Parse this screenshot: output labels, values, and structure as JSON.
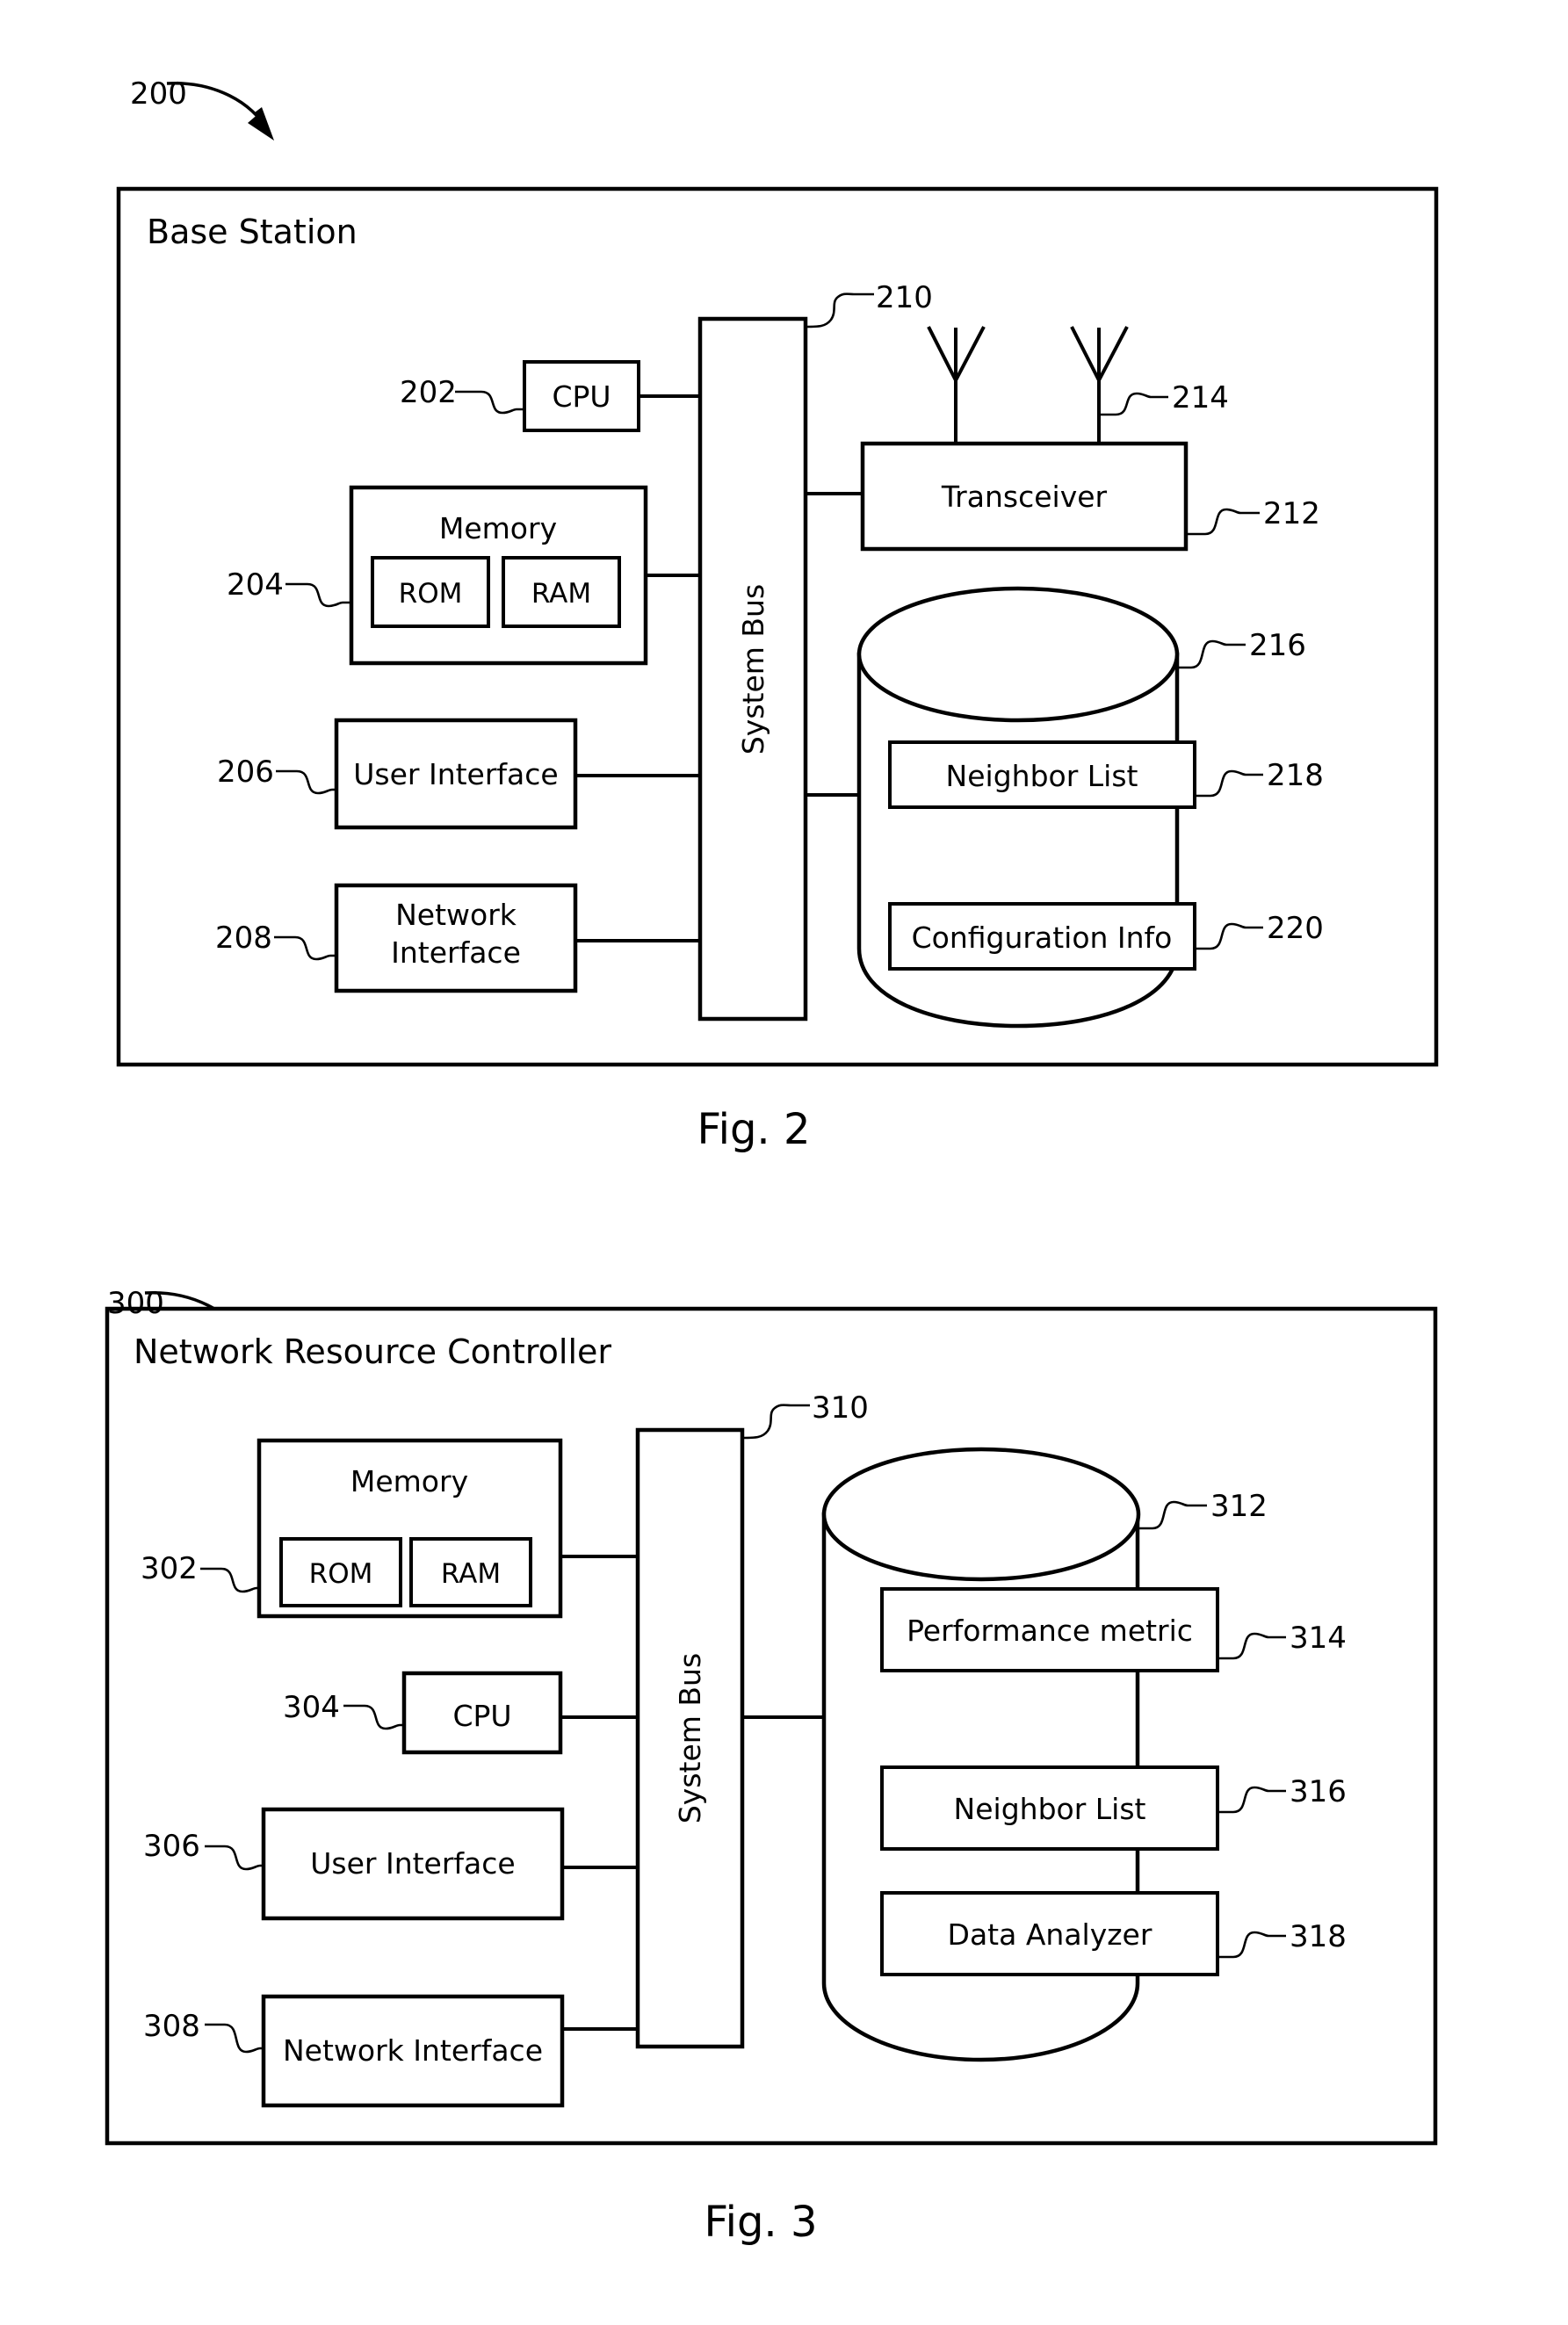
{
  "figures": [
    {
      "id": "fig2",
      "caption": "Fig. 2",
      "lead_ref": "200",
      "outer_label": "Base Station",
      "refs": {
        "cpu": "202",
        "memory": "204",
        "user_interface": "206",
        "network_interface": "208",
        "system_bus": "210",
        "transceiver": "212",
        "antenna": "214",
        "database": "216",
        "neighbor_list": "218",
        "configuration_info": "220"
      },
      "nodes": {
        "cpu": "CPU",
        "memory": "Memory",
        "rom": "ROM",
        "ram": "RAM",
        "user_interface": "User Interface",
        "network_interface_line1": "Network",
        "network_interface_line2": "Interface",
        "system_bus": "System Bus",
        "transceiver": "Transceiver",
        "neighbor_list": "Neighbor List",
        "configuration_info": "Configuration Info"
      }
    },
    {
      "id": "fig3",
      "caption": "Fig. 3",
      "lead_ref": "300",
      "outer_label": "Network Resource Controller",
      "refs": {
        "memory": "302",
        "cpu": "304",
        "user_interface": "306",
        "network_interface": "308",
        "system_bus": "310",
        "database": "312",
        "performance_metric": "314",
        "neighbor_list": "316",
        "data_analyzer": "318"
      },
      "nodes": {
        "memory": "Memory",
        "rom": "ROM",
        "ram": "RAM",
        "cpu": "CPU",
        "user_interface": "User Interface",
        "network_interface": "Network Interface",
        "system_bus": "System Bus",
        "performance_metric": "Performance metric",
        "neighbor_list": "Neighbor List",
        "data_analyzer": "Data Analyzer"
      }
    }
  ],
  "style": {
    "ink": "#000000",
    "paper": "#ffffff"
  }
}
